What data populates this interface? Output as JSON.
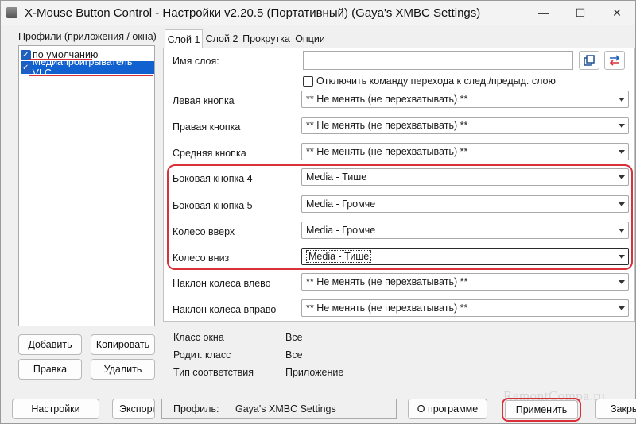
{
  "window": {
    "title": "X-Mouse Button Control - Настройки v2.20.5 (Портативный) (Gaya's XMBC Settings)",
    "minimize": "—",
    "maximize": "☐",
    "close": "✕"
  },
  "profiles": {
    "label": "Профили (приложения / окна)",
    "items": [
      {
        "label": "по умолчанию",
        "checked": true
      },
      {
        "label": "Медиапроигрыватель VLC",
        "checked": true,
        "selected": true
      }
    ],
    "add": "Добавить",
    "copy": "Копировать",
    "edit": "Правка",
    "delete": "Удалить"
  },
  "tabs": [
    "Слой 1",
    "Слой 2",
    "Прокрутка",
    "Опции"
  ],
  "layer": {
    "name_label": "Имя слоя:",
    "name_value": "",
    "disable_nav_label": "Отключить команду перехода к след./предыд. слою",
    "rows": [
      {
        "label": "Левая кнопка",
        "value": "** Не менять (не перехватывать) **"
      },
      {
        "label": "Правая кнопка",
        "value": "** Не менять (не перехватывать) **"
      },
      {
        "label": "Средняя кнопка",
        "value": "** Не менять (не перехватывать) **"
      },
      {
        "label": "Боковая кнопка 4",
        "value": "Media - Тише"
      },
      {
        "label": "Боковая кнопка 5",
        "value": "Media - Громче"
      },
      {
        "label": "Колесо вверх",
        "value": "Media - Громче"
      },
      {
        "label": "Колесо вниз",
        "value": "Media - Тише"
      },
      {
        "label": "Наклон колеса влево",
        "value": "** Не менять (не перехватывать) **"
      },
      {
        "label": "Наклон колеса вправо",
        "value": "** Не менять (не перехватывать) **"
      }
    ]
  },
  "info": {
    "window_class_label": "Класс окна",
    "window_class_value": "Все",
    "parent_class_label": "Родит. класс",
    "parent_class_value": "Все",
    "match_type_label": "Тип соответствия",
    "match_type_value": "Приложение"
  },
  "footer": {
    "settings": "Настройки",
    "export": "Экспорт",
    "profile_label": "Профиль:",
    "profile_value": "Gaya's XMBC Settings",
    "about": "О программе",
    "apply": "Применить",
    "close": "Закрыть"
  },
  "watermark": "RemontCompa.ru",
  "colors": {
    "highlight": "#d9303a",
    "selection": "#1060d0"
  }
}
